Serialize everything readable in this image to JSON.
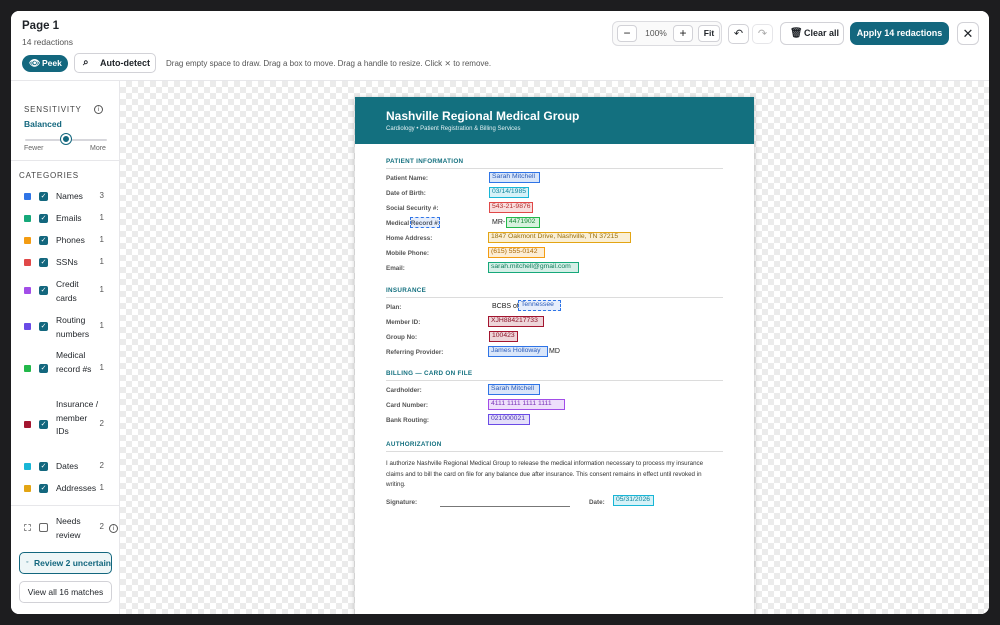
{
  "header": {
    "title": "Page 1",
    "subtitle": "14 redactions",
    "zoom_minus": "−",
    "zoom_value": "100%",
    "zoom_plus": "+",
    "fit_label": "Fit",
    "undo_icon": "↶",
    "redo_icon": "↷",
    "clear_icon": "🗑",
    "clear_label": "Clear all",
    "apply_label": "Apply 14 redactions",
    "close_icon": "✕",
    "peek_icon": "👁",
    "peek_label": "Peek",
    "autodetect_icon": "⌕",
    "autodetect_label": "Auto-detect",
    "hint": "Drag empty space to draw. Drag a box to move. Drag a handle to resize. Click ⨯ to remove."
  },
  "sidebar": {
    "sensitivity_label": "SENSITIVITY",
    "info_icon": "i",
    "sensitivity_value": "Balanced",
    "slider_level": 0.5,
    "fewer_label": "Fewer",
    "more_label": "More",
    "categories_label": "CATEGORIES",
    "check_glyph": "✓",
    "categories": [
      {
        "name": "Names",
        "count": "3",
        "color": "#2f74e6"
      },
      {
        "name": "Emails",
        "count": "1",
        "color": "#16a87a"
      },
      {
        "name": "Phones",
        "count": "1",
        "color": "#f39c12"
      },
      {
        "name": "SSNs",
        "count": "1",
        "color": "#e04848"
      },
      {
        "name": "Credit cards",
        "count": "1",
        "color": "#a24de8"
      },
      {
        "name": "Routing numbers",
        "count": "1",
        "color": "#6a4be6"
      },
      {
        "name": "Medical record #s",
        "count": "1",
        "color": "#22b84a"
      },
      {
        "name": "Insurance / member IDs",
        "count": "2",
        "color": "#a3152f"
      },
      {
        "name": "Dates",
        "count": "2",
        "color": "#18b6d6"
      },
      {
        "name": "Addresses",
        "count": "1",
        "color": "#e3a514"
      }
    ],
    "needs_review": {
      "name": "Needs review",
      "count": "2"
    },
    "review_label": "Review 2 uncertain",
    "review_dot": "◦",
    "view_all_label": "View all 16 matches"
  },
  "document": {
    "org_name": "Nashville Regional Medical Group",
    "org_sub": "Cardiology  •  Patient Registration & Billing Services",
    "patient_heading": "PATIENT INFORMATION",
    "fields": {
      "patient_name_label": "Patient Name:",
      "patient_name": "Sarah Mitchell",
      "dob_label": "Date of Birth:",
      "dob": "03/14/1985",
      "ssn_label": "Social Security #:",
      "ssn": "543-21-9876",
      "mrn_label": "Medical Record #:",
      "mrn_prefix": "MR-",
      "mrn": "4471902",
      "address_label": "Home Address:",
      "address": "1847 Oakmont Drive, Nashville, TN 37215",
      "phone_label": "Mobile Phone:",
      "phone": "(615) 555-0142",
      "email_label": "Email:",
      "email": "sarah.mitchell@gmail.com"
    },
    "insurance_heading": "INSURANCE",
    "insurance": {
      "plan_label": "Plan:",
      "plan_prefix": "BCBS of",
      "plan": "Tennessee",
      "member_label": "Member ID:",
      "member": "XJH884217733",
      "group_label": "Group No:",
      "group": "100423",
      "provider_label": "Referring Provider:",
      "provider": "James Holloway",
      "provider_suffix": "MD"
    },
    "billing_heading": "BILLING  —  CARD ON FILE",
    "billing": {
      "cardholder_label": "Cardholder:",
      "cardholder": "Sarah Mitchell",
      "card_label": "Card Number:",
      "card": "4111 1111 1111 1111",
      "routing_label": "Bank Routing:",
      "routing": "021000021"
    },
    "auth_heading": "AUTHORIZATION",
    "auth_text": "I authorize Nashville Regional Medical Group to release the medical information necessary to process my insurance claims and to bill the card on file for any balance due after insurance. This consent remains in effect until revoked in writing.",
    "signature_label": "Signature:",
    "date_label": "Date:",
    "date": "05/31/2026"
  }
}
